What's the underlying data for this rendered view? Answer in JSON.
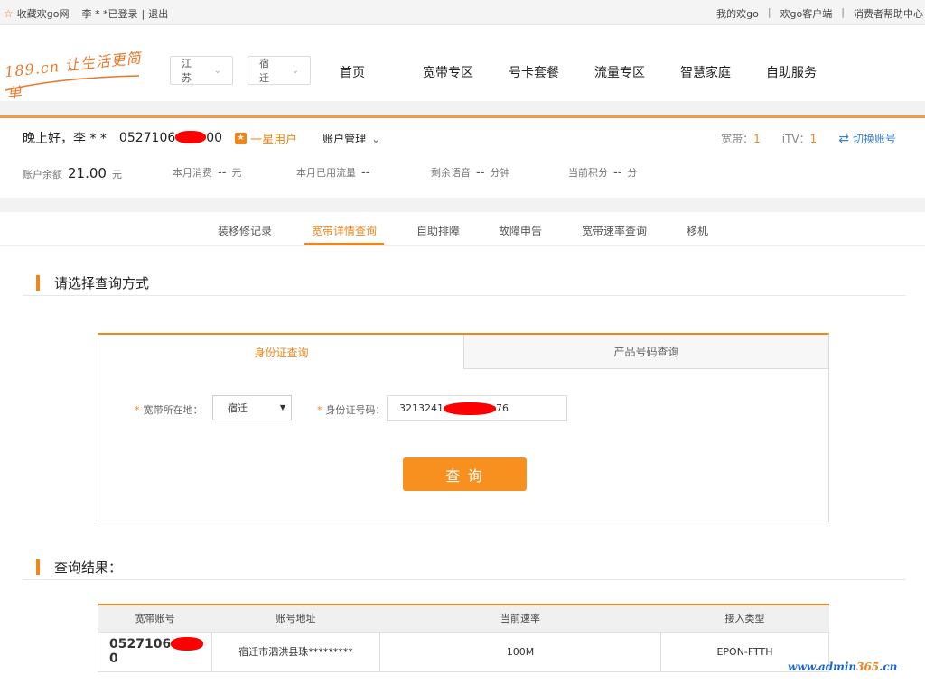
{
  "topbar": {
    "favorite": "收藏欢go网",
    "user_status": "李 * *已登录",
    "logout": "退出",
    "divider": "|",
    "links": [
      "我的欢go",
      "欢go客户端",
      "消费者帮助中心"
    ]
  },
  "header": {
    "logo_text": "189.cn 让生活更简单",
    "province": "江苏",
    "city": "宿迁",
    "nav": [
      "首页",
      "宽带专区",
      "号卡套餐",
      "流量专区",
      "智慧家庭",
      "自助服务"
    ]
  },
  "user": {
    "greeting": "晚上好，李 * *",
    "phone_prefix": "0527106",
    "phone_suffix": "00",
    "level": "一星用户",
    "level_icon": "star-badge-icon",
    "account_manage": "账户管理",
    "broadband_label": "宽带：",
    "broadband_count": "1",
    "itv_label": "iTV：",
    "itv_count": "1",
    "switch_account": "切换账号"
  },
  "stats": {
    "balance_label": "账户余额",
    "balance_value": "21.00",
    "balance_unit": "元",
    "monthly_label": "本月消费",
    "monthly_value": "--",
    "monthly_unit": "元",
    "traffic_label": "本月已用流量",
    "traffic_value": "--",
    "voice_label": "剩余语音",
    "voice_value": "--",
    "voice_unit": "分钟",
    "points_label": "当前积分",
    "points_value": "--",
    "points_unit": "分"
  },
  "subtabs": [
    "装移修记录",
    "宽带详情查询",
    "自助排障",
    "故障申告",
    "宽带速率查询",
    "移机"
  ],
  "query": {
    "section_title": "请选择查询方式",
    "tab_id": "身份证查询",
    "tab_product": "产品号码查询",
    "required_mark": "*",
    "location_label": "宽带所在地：",
    "location_value": "宿迁",
    "id_label": "身份证号码：",
    "id_prefix": "3213241",
    "id_suffix": "76",
    "button": "查 询"
  },
  "results": {
    "section_title": "查询结果：",
    "columns": [
      "宽带账号",
      "账号地址",
      "当前速率",
      "接入类型"
    ],
    "row": {
      "account_prefix": "0527106",
      "account_suffix": "0",
      "address": "宿迁市泗洪县珠*********",
      "speed": "100M",
      "access": "EPON-FTTH"
    }
  },
  "watermark": {
    "part1": "www.admin",
    "part2": "365",
    "part3": ".cn"
  },
  "colors": {
    "accent": "#f08519",
    "link_blue": "#3b7fd0",
    "redaction": "#ff0000"
  }
}
